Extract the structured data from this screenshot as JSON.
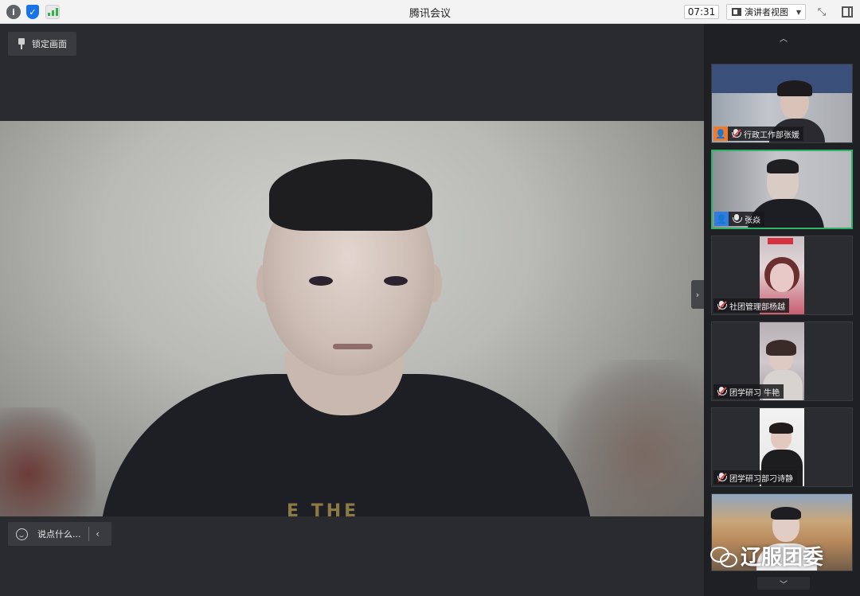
{
  "window": {
    "title": "腾讯会议",
    "timer": "07:31",
    "view_mode": "演讲者视图"
  },
  "stage": {
    "lock_label": "锁定画面",
    "chat_placeholder": "说点什么...",
    "shirt_text": "E THE"
  },
  "participants": [
    {
      "name": "行政工作部张媛",
      "avatar": "orange"
    },
    {
      "name": "张焱",
      "avatar": "blue",
      "active": true
    },
    {
      "name": "社团管理部杨越"
    },
    {
      "name": "团学研习 牛艳"
    },
    {
      "name": "团学研习部刁诗静"
    },
    {
      "name": ""
    }
  ],
  "watermark": {
    "text": "辽服团委"
  },
  "colors": {
    "accent_green": "#2fb36a",
    "avatar_orange": "#f07a2c",
    "avatar_blue": "#2f7de0",
    "signal_green": "#2fb34a"
  }
}
